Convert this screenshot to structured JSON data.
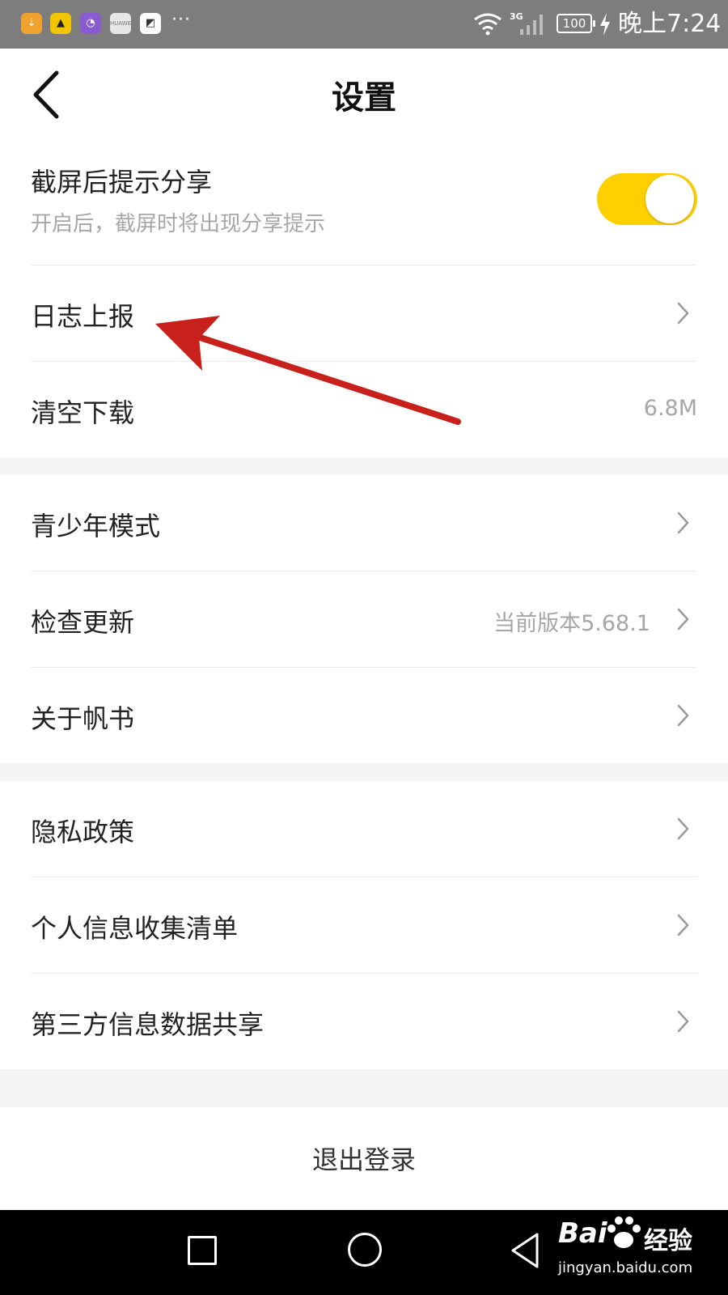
{
  "status_bar": {
    "apps": [
      {
        "name": "app-orange",
        "color": "#f0a22e"
      },
      {
        "name": "app-yellow",
        "color": "#f3c500"
      },
      {
        "name": "app-purple",
        "color": "#8a5cd2"
      },
      {
        "name": "app-huawei",
        "color": "#e0e0e0"
      },
      {
        "name": "app-white",
        "color": "#ffffff"
      }
    ],
    "more": "···",
    "network": "3G",
    "battery": "100",
    "time": "晚上7:24"
  },
  "header": {
    "title": "设置"
  },
  "settings": {
    "screenshot_share": {
      "label": "截屏后提示分享",
      "sub": "开启后，截屏时将出现分享提示",
      "enabled": true
    },
    "log_report": "日志上报",
    "clear_download": {
      "label": "清空下载",
      "value": "6.8M"
    },
    "teen_mode": "青少年模式",
    "check_update": {
      "label": "检查更新",
      "value": "当前版本5.68.1"
    },
    "about": "关于帆书",
    "privacy_policy": "隐私政策",
    "personal_info_list": "个人信息收集清单",
    "third_party_sharing": "第三方信息数据共享"
  },
  "logout_label": "退出登录",
  "watermark": {
    "brand_left": "Bai",
    "brand_right": "经验",
    "url": "jingyan.baidu.com"
  },
  "colors": {
    "accent": "#ffd000",
    "annotation_arrow": "#c8201a",
    "status_bar": "#7d7d7d"
  }
}
